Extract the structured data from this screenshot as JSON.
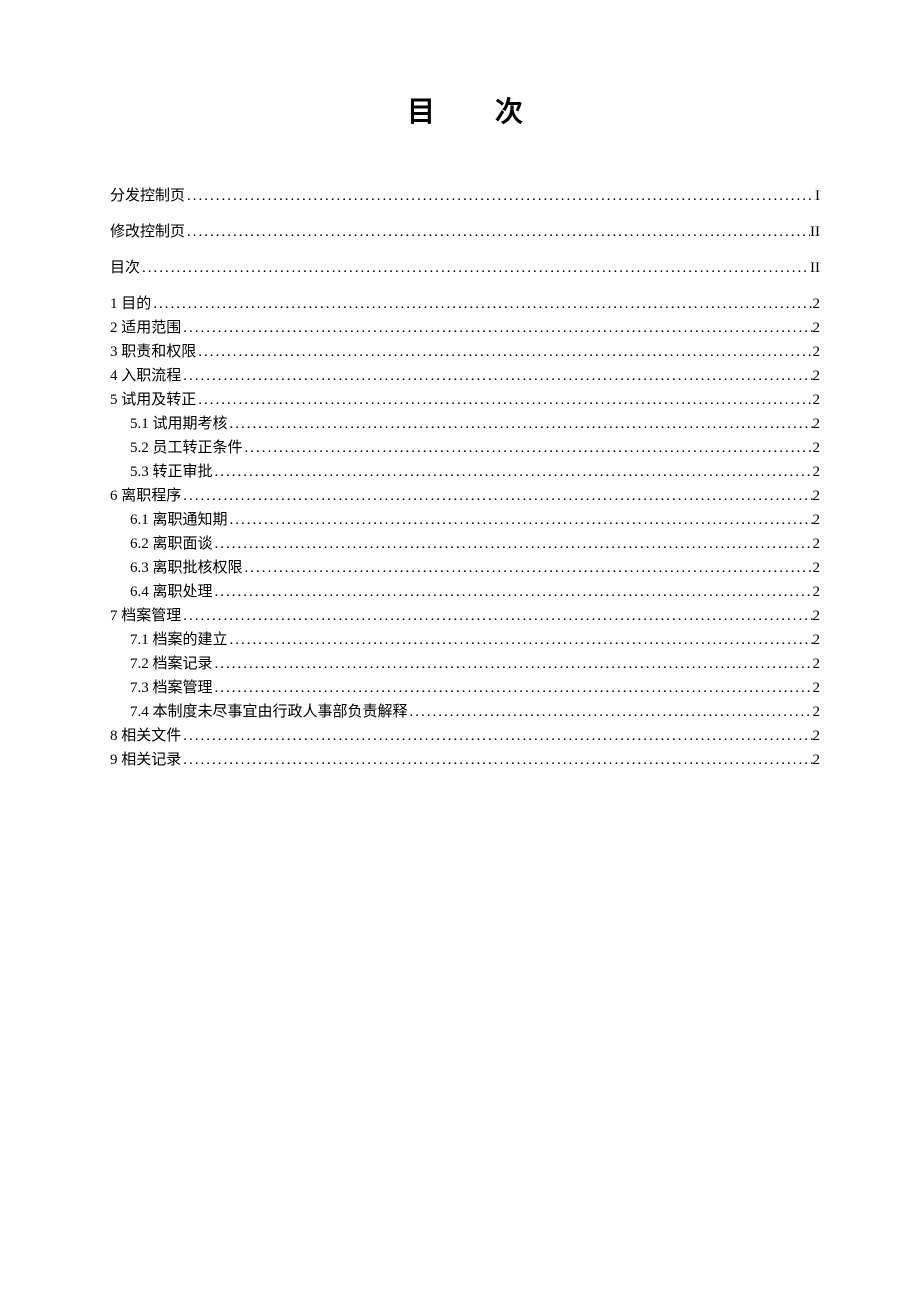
{
  "title": "目次",
  "toc": [
    {
      "level": 1,
      "pre": true,
      "label": "分发控制页",
      "page": "I"
    },
    {
      "level": 1,
      "pre": true,
      "label": "修改控制页",
      "page": "II"
    },
    {
      "level": 1,
      "pre": true,
      "label": "目次",
      "page": "II"
    },
    {
      "level": 1,
      "pre": false,
      "label": "1 目的",
      "page": "2"
    },
    {
      "level": 1,
      "pre": false,
      "label": "2 适用范围",
      "page": "2"
    },
    {
      "level": 1,
      "pre": false,
      "label": "3 职责和权限",
      "page": "2"
    },
    {
      "level": 1,
      "pre": false,
      "label": "4 入职流程",
      "page": "2"
    },
    {
      "level": 1,
      "pre": false,
      "label": "5 试用及转正",
      "page": "2"
    },
    {
      "level": 2,
      "pre": false,
      "label": "5.1 试用期考核",
      "page": "2"
    },
    {
      "level": 2,
      "pre": false,
      "label": "5.2 员工转正条件",
      "page": "2"
    },
    {
      "level": 2,
      "pre": false,
      "label": "5.3 转正审批",
      "page": "2"
    },
    {
      "level": 1,
      "pre": false,
      "label": "6 离职程序",
      "page": "2"
    },
    {
      "level": 2,
      "pre": false,
      "label": "6.1 离职通知期",
      "page": "2"
    },
    {
      "level": 2,
      "pre": false,
      "label": "6.2 离职面谈",
      "page": "2"
    },
    {
      "level": 2,
      "pre": false,
      "label": "6.3 离职批核权限",
      "page": "2"
    },
    {
      "level": 2,
      "pre": false,
      "label": "6.4 离职处理",
      "page": "2"
    },
    {
      "level": 1,
      "pre": false,
      "label": "7 档案管理",
      "page": "2"
    },
    {
      "level": 2,
      "pre": false,
      "label": "7.1 档案的建立",
      "page": "2"
    },
    {
      "level": 2,
      "pre": false,
      "label": "7.2 档案记录",
      "page": "2"
    },
    {
      "level": 2,
      "pre": false,
      "label": "7.3 档案管理",
      "page": "2"
    },
    {
      "level": 2,
      "pre": false,
      "label": "7.4 本制度未尽事宜由行政人事部负责解释",
      "page": "2"
    },
    {
      "level": 1,
      "pre": false,
      "label": "8 相关文件",
      "page": "2"
    },
    {
      "level": 1,
      "pre": false,
      "label": "9 相关记录",
      "page": "2"
    }
  ],
  "dots": "..........................................................................................................................................................................................."
}
